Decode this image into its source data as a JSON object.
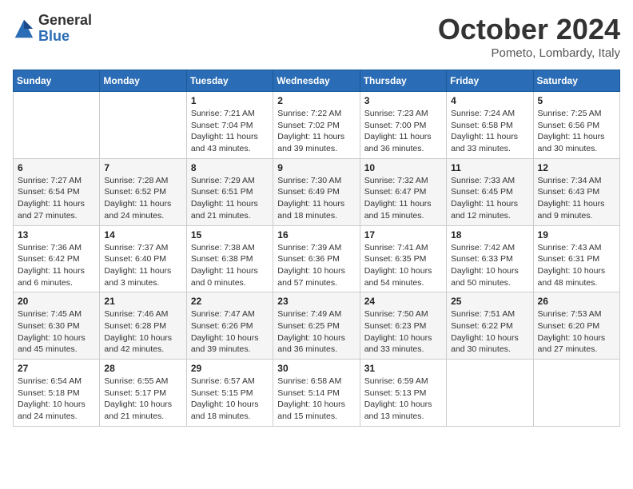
{
  "logo": {
    "general": "General",
    "blue": "Blue"
  },
  "title": "October 2024",
  "subtitle": "Pometo, Lombardy, Italy",
  "days_header": [
    "Sunday",
    "Monday",
    "Tuesday",
    "Wednesday",
    "Thursday",
    "Friday",
    "Saturday"
  ],
  "weeks": [
    [
      {
        "day": "",
        "info": ""
      },
      {
        "day": "",
        "info": ""
      },
      {
        "day": "1",
        "info": "Sunrise: 7:21 AM\nSunset: 7:04 PM\nDaylight: 11 hours and 43 minutes."
      },
      {
        "day": "2",
        "info": "Sunrise: 7:22 AM\nSunset: 7:02 PM\nDaylight: 11 hours and 39 minutes."
      },
      {
        "day": "3",
        "info": "Sunrise: 7:23 AM\nSunset: 7:00 PM\nDaylight: 11 hours and 36 minutes."
      },
      {
        "day": "4",
        "info": "Sunrise: 7:24 AM\nSunset: 6:58 PM\nDaylight: 11 hours and 33 minutes."
      },
      {
        "day": "5",
        "info": "Sunrise: 7:25 AM\nSunset: 6:56 PM\nDaylight: 11 hours and 30 minutes."
      }
    ],
    [
      {
        "day": "6",
        "info": "Sunrise: 7:27 AM\nSunset: 6:54 PM\nDaylight: 11 hours and 27 minutes."
      },
      {
        "day": "7",
        "info": "Sunrise: 7:28 AM\nSunset: 6:52 PM\nDaylight: 11 hours and 24 minutes."
      },
      {
        "day": "8",
        "info": "Sunrise: 7:29 AM\nSunset: 6:51 PM\nDaylight: 11 hours and 21 minutes."
      },
      {
        "day": "9",
        "info": "Sunrise: 7:30 AM\nSunset: 6:49 PM\nDaylight: 11 hours and 18 minutes."
      },
      {
        "day": "10",
        "info": "Sunrise: 7:32 AM\nSunset: 6:47 PM\nDaylight: 11 hours and 15 minutes."
      },
      {
        "day": "11",
        "info": "Sunrise: 7:33 AM\nSunset: 6:45 PM\nDaylight: 11 hours and 12 minutes."
      },
      {
        "day": "12",
        "info": "Sunrise: 7:34 AM\nSunset: 6:43 PM\nDaylight: 11 hours and 9 minutes."
      }
    ],
    [
      {
        "day": "13",
        "info": "Sunrise: 7:36 AM\nSunset: 6:42 PM\nDaylight: 11 hours and 6 minutes."
      },
      {
        "day": "14",
        "info": "Sunrise: 7:37 AM\nSunset: 6:40 PM\nDaylight: 11 hours and 3 minutes."
      },
      {
        "day": "15",
        "info": "Sunrise: 7:38 AM\nSunset: 6:38 PM\nDaylight: 11 hours and 0 minutes."
      },
      {
        "day": "16",
        "info": "Sunrise: 7:39 AM\nSunset: 6:36 PM\nDaylight: 10 hours and 57 minutes."
      },
      {
        "day": "17",
        "info": "Sunrise: 7:41 AM\nSunset: 6:35 PM\nDaylight: 10 hours and 54 minutes."
      },
      {
        "day": "18",
        "info": "Sunrise: 7:42 AM\nSunset: 6:33 PM\nDaylight: 10 hours and 50 minutes."
      },
      {
        "day": "19",
        "info": "Sunrise: 7:43 AM\nSunset: 6:31 PM\nDaylight: 10 hours and 48 minutes."
      }
    ],
    [
      {
        "day": "20",
        "info": "Sunrise: 7:45 AM\nSunset: 6:30 PM\nDaylight: 10 hours and 45 minutes."
      },
      {
        "day": "21",
        "info": "Sunrise: 7:46 AM\nSunset: 6:28 PM\nDaylight: 10 hours and 42 minutes."
      },
      {
        "day": "22",
        "info": "Sunrise: 7:47 AM\nSunset: 6:26 PM\nDaylight: 10 hours and 39 minutes."
      },
      {
        "day": "23",
        "info": "Sunrise: 7:49 AM\nSunset: 6:25 PM\nDaylight: 10 hours and 36 minutes."
      },
      {
        "day": "24",
        "info": "Sunrise: 7:50 AM\nSunset: 6:23 PM\nDaylight: 10 hours and 33 minutes."
      },
      {
        "day": "25",
        "info": "Sunrise: 7:51 AM\nSunset: 6:22 PM\nDaylight: 10 hours and 30 minutes."
      },
      {
        "day": "26",
        "info": "Sunrise: 7:53 AM\nSunset: 6:20 PM\nDaylight: 10 hours and 27 minutes."
      }
    ],
    [
      {
        "day": "27",
        "info": "Sunrise: 6:54 AM\nSunset: 5:18 PM\nDaylight: 10 hours and 24 minutes."
      },
      {
        "day": "28",
        "info": "Sunrise: 6:55 AM\nSunset: 5:17 PM\nDaylight: 10 hours and 21 minutes."
      },
      {
        "day": "29",
        "info": "Sunrise: 6:57 AM\nSunset: 5:15 PM\nDaylight: 10 hours and 18 minutes."
      },
      {
        "day": "30",
        "info": "Sunrise: 6:58 AM\nSunset: 5:14 PM\nDaylight: 10 hours and 15 minutes."
      },
      {
        "day": "31",
        "info": "Sunrise: 6:59 AM\nSunset: 5:13 PM\nDaylight: 10 hours and 13 minutes."
      },
      {
        "day": "",
        "info": ""
      },
      {
        "day": "",
        "info": ""
      }
    ]
  ]
}
